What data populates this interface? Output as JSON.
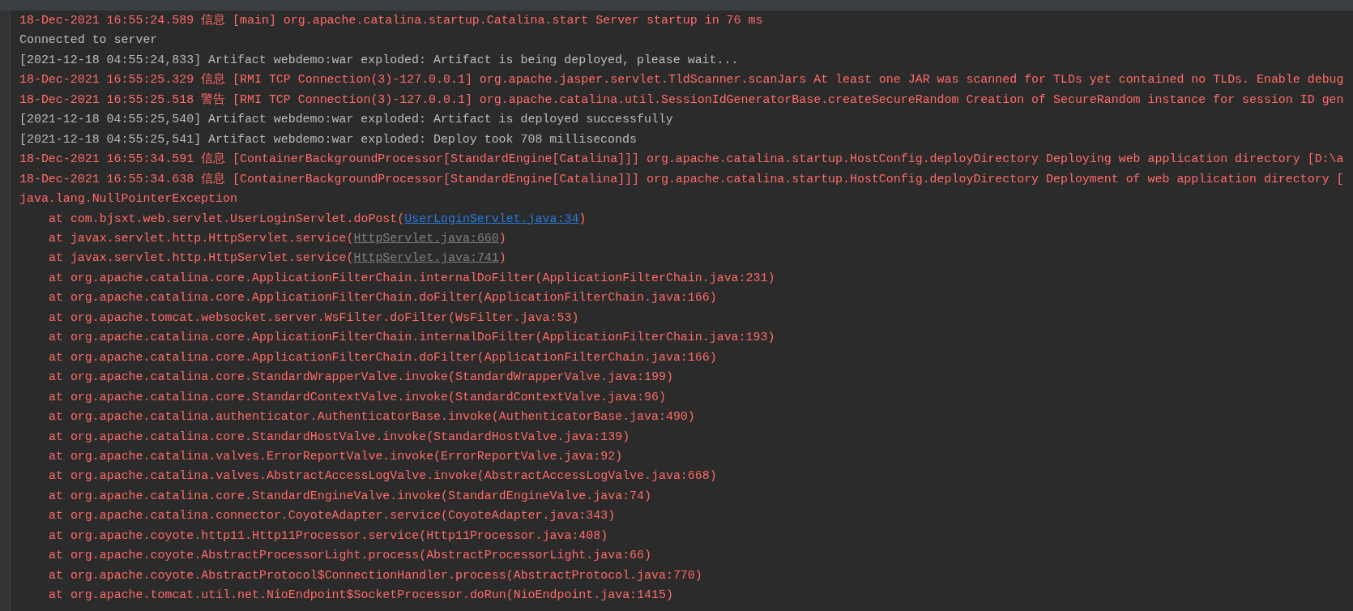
{
  "console": {
    "lines": [
      {
        "kind": "error",
        "segments": [
          {
            "kind": "text",
            "text": "18-Dec-2021 16:55:24.589 信息 [main] org.apache.catalina.startup.Catalina.start Server startup in 76 ms"
          }
        ]
      },
      {
        "kind": "output",
        "segments": [
          {
            "kind": "text",
            "text": "Connected to server"
          }
        ]
      },
      {
        "kind": "output",
        "segments": [
          {
            "kind": "text",
            "text": "[2021-12-18 04:55:24,833] Artifact webdemo:war exploded: Artifact is being deployed, please wait..."
          }
        ]
      },
      {
        "kind": "error",
        "segments": [
          {
            "kind": "text",
            "text": "18-Dec-2021 16:55:25.329 信息 [RMI TCP Connection(3)-127.0.0.1] org.apache.jasper.servlet.TldScanner.scanJars At least one JAR was scanned for TLDs yet contained no TLDs. Enable debug"
          }
        ]
      },
      {
        "kind": "error",
        "segments": [
          {
            "kind": "text",
            "text": "18-Dec-2021 16:55:25.518 警告 [RMI TCP Connection(3)-127.0.0.1] org.apache.catalina.util.SessionIdGeneratorBase.createSecureRandom Creation of SecureRandom instance for session ID gen"
          }
        ]
      },
      {
        "kind": "output",
        "segments": [
          {
            "kind": "text",
            "text": "[2021-12-18 04:55:25,540] Artifact webdemo:war exploded: Artifact is deployed successfully"
          }
        ]
      },
      {
        "kind": "output",
        "segments": [
          {
            "kind": "text",
            "text": "[2021-12-18 04:55:25,541] Artifact webdemo:war exploded: Deploy took 708 milliseconds"
          }
        ]
      },
      {
        "kind": "error",
        "segments": [
          {
            "kind": "text",
            "text": "18-Dec-2021 16:55:34.591 信息 [ContainerBackgroundProcessor[StandardEngine[Catalina]]] org.apache.catalina.startup.HostConfig.deployDirectory Deploying web application directory [D:\\a"
          }
        ]
      },
      {
        "kind": "error",
        "segments": [
          {
            "kind": "text",
            "text": "18-Dec-2021 16:55:34.638 信息 [ContainerBackgroundProcessor[StandardEngine[Catalina]]] org.apache.catalina.startup.HostConfig.deployDirectory Deployment of web application directory ["
          }
        ]
      },
      {
        "kind": "error",
        "segments": [
          {
            "kind": "text",
            "text": "java.lang.NullPointerException"
          }
        ],
        "children": [
          {
            "kind": "error",
            "segments": [
              {
                "kind": "text",
                "text": "at com.bjsxt.web.servlet.UserLoginServlet.doPost("
              },
              {
                "kind": "project-link",
                "text": "UserLoginServlet.java:34"
              },
              {
                "kind": "text",
                "text": ")"
              }
            ]
          },
          {
            "kind": "error",
            "segments": [
              {
                "kind": "text",
                "text": "at javax.servlet.http.HttpServlet.service("
              },
              {
                "kind": "library-link",
                "text": "HttpServlet.java:660"
              },
              {
                "kind": "text",
                "text": ")"
              }
            ]
          },
          {
            "kind": "error",
            "segments": [
              {
                "kind": "text",
                "text": "at javax.servlet.http.HttpServlet.service("
              },
              {
                "kind": "library-link",
                "text": "HttpServlet.java:741"
              },
              {
                "kind": "text",
                "text": ")"
              }
            ]
          },
          {
            "kind": "error",
            "segments": [
              {
                "kind": "text",
                "text": "at org.apache.catalina.core.ApplicationFilterChain.internalDoFilter(ApplicationFilterChain.java:231)"
              }
            ]
          },
          {
            "kind": "error",
            "segments": [
              {
                "kind": "text",
                "text": "at org.apache.catalina.core.ApplicationFilterChain.doFilter(ApplicationFilterChain.java:166)"
              }
            ]
          },
          {
            "kind": "error",
            "segments": [
              {
                "kind": "text",
                "text": "at org.apache.tomcat.websocket.server.WsFilter.doFilter(WsFilter.java:53)"
              }
            ]
          },
          {
            "kind": "error",
            "segments": [
              {
                "kind": "text",
                "text": "at org.apache.catalina.core.ApplicationFilterChain.internalDoFilter(ApplicationFilterChain.java:193)"
              }
            ]
          },
          {
            "kind": "error",
            "segments": [
              {
                "kind": "text",
                "text": "at org.apache.catalina.core.ApplicationFilterChain.doFilter(ApplicationFilterChain.java:166)"
              }
            ]
          },
          {
            "kind": "error",
            "segments": [
              {
                "kind": "text",
                "text": "at org.apache.catalina.core.StandardWrapperValve.invoke(StandardWrapperValve.java:199)"
              }
            ]
          },
          {
            "kind": "error",
            "segments": [
              {
                "kind": "text",
                "text": "at org.apache.catalina.core.StandardContextValve.invoke(StandardContextValve.java:96)"
              }
            ]
          },
          {
            "kind": "error",
            "segments": [
              {
                "kind": "text",
                "text": "at org.apache.catalina.authenticator.AuthenticatorBase.invoke(AuthenticatorBase.java:490)"
              }
            ]
          },
          {
            "kind": "error",
            "segments": [
              {
                "kind": "text",
                "text": "at org.apache.catalina.core.StandardHostValve.invoke(StandardHostValve.java:139)"
              }
            ]
          },
          {
            "kind": "error",
            "segments": [
              {
                "kind": "text",
                "text": "at org.apache.catalina.valves.ErrorReportValve.invoke(ErrorReportValve.java:92)"
              }
            ]
          },
          {
            "kind": "error",
            "segments": [
              {
                "kind": "text",
                "text": "at org.apache.catalina.valves.AbstractAccessLogValve.invoke(AbstractAccessLogValve.java:668)"
              }
            ]
          },
          {
            "kind": "error",
            "segments": [
              {
                "kind": "text",
                "text": "at org.apache.catalina.core.StandardEngineValve.invoke(StandardEngineValve.java:74)"
              }
            ]
          },
          {
            "kind": "error",
            "segments": [
              {
                "kind": "text",
                "text": "at org.apache.catalina.connector.CoyoteAdapter.service(CoyoteAdapter.java:343)"
              }
            ]
          },
          {
            "kind": "error",
            "segments": [
              {
                "kind": "text",
                "text": "at org.apache.coyote.http11.Http11Processor.service(Http11Processor.java:408)"
              }
            ]
          },
          {
            "kind": "error",
            "segments": [
              {
                "kind": "text",
                "text": "at org.apache.coyote.AbstractProcessorLight.process(AbstractProcessorLight.java:66)"
              }
            ]
          },
          {
            "kind": "error",
            "segments": [
              {
                "kind": "text",
                "text": "at org.apache.coyote.AbstractProtocol$ConnectionHandler.process(AbstractProtocol.java:770)"
              }
            ]
          },
          {
            "kind": "error",
            "segments": [
              {
                "kind": "text",
                "text": "at org.apache.tomcat.util.net.NioEndpoint$SocketProcessor.doRun(NioEndpoint.java:1415)"
              }
            ]
          }
        ]
      }
    ]
  }
}
